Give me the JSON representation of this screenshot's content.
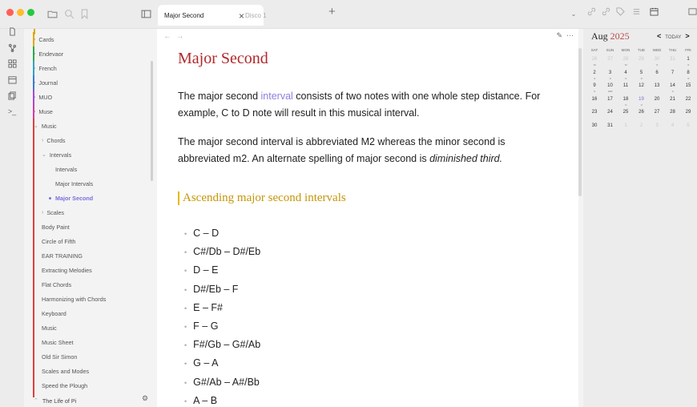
{
  "tabs": [
    {
      "label": "Major Second",
      "active": true
    },
    {
      "label": "Disco 1",
      "active": false
    }
  ],
  "sidebar": {
    "items": [
      {
        "label": "Cards",
        "color": "#e0a800",
        "chevron": ">",
        "depth": 0
      },
      {
        "label": "Endevaor",
        "color": "#2fa94f",
        "chevron": ">",
        "depth": 0
      },
      {
        "label": "French",
        "color": "#33a3c7",
        "chevron": ">",
        "depth": 0
      },
      {
        "label": "Journal",
        "color": "#3b7bd6",
        "chevron": ">",
        "depth": 0
      },
      {
        "label": "MUO",
        "color": "#a44ad8",
        "chevron": ">",
        "depth": 0
      },
      {
        "label": "Muse",
        "color": "#d63ca6",
        "chevron": ">",
        "depth": 0
      },
      {
        "label": "Music",
        "color": "#e13d3d",
        "chevron": "v",
        "depth": 0
      },
      {
        "label": "Chords",
        "chevron": ">",
        "depth": 1
      },
      {
        "label": "Intervals",
        "chevron": "v",
        "depth": 1
      },
      {
        "label": "Intervals",
        "depth": 2
      },
      {
        "label": "Major Intervals",
        "depth": 2
      },
      {
        "label": "Major Second",
        "depth": 2,
        "selected": true
      },
      {
        "label": "Scales",
        "chevron": ">",
        "depth": 1
      },
      {
        "label": "Body Paint",
        "depth": 1
      },
      {
        "label": "Circle of Fifth",
        "depth": 1
      },
      {
        "label": "EAR TRAINING",
        "depth": 1
      },
      {
        "label": "Extracting Melodies",
        "depth": 1
      },
      {
        "label": "Flat Chords",
        "depth": 1
      },
      {
        "label": "Harmonizing with Chords",
        "depth": 1
      },
      {
        "label": "Keyboard",
        "depth": 1
      },
      {
        "label": "Music",
        "depth": 1
      },
      {
        "label": "Music Sheet",
        "depth": 1
      },
      {
        "label": "Old Sir Simon",
        "depth": 1
      },
      {
        "label": "Scales and Modes",
        "depth": 1
      },
      {
        "label": "Speed the Plough",
        "depth": 1
      }
    ],
    "vault_name": "The Life of Pi"
  },
  "note": {
    "title": "Major Second",
    "para1_before": "The major second ",
    "para1_link": "interval",
    "para1_after": " consists of two notes with one whole step distance. For example, C to D note will result in this musical interval.",
    "para2_before": "The major second interval is abbreviated M2 whereas the minor second is abbreviated m2. An alternate spelling of major second is ",
    "para2_em": "diminished third.",
    "heading": "Ascending major second intervals",
    "list": [
      "C – D",
      "C#/Db – D#/Eb",
      "D – E",
      "D#/Eb – F",
      "E – F#",
      "F – G",
      "F#/Gb – G#/Ab",
      "G – A",
      "G#/Ab – A#/Bb",
      "A – B"
    ]
  },
  "calendar": {
    "month": "Aug",
    "year": "2025",
    "today_label": "TODAY",
    "prev": "<",
    "next": ">",
    "weekdays": [
      "SAT",
      "SUN",
      "MON",
      "TUE",
      "WED",
      "THU",
      "FRI"
    ],
    "weeks": [
      [
        {
          "d": "26",
          "dim": true,
          "dots": "•••"
        },
        {
          "d": "27",
          "dim": true
        },
        {
          "d": "28",
          "dim": true,
          "dots": "•••"
        },
        {
          "d": "29",
          "dim": true
        },
        {
          "d": "30",
          "dim": true,
          "dots": "••"
        },
        {
          "d": "31",
          "dim": true
        },
        {
          "d": "1",
          "dots": "••"
        }
      ],
      [
        {
          "d": "2",
          "dots": "••"
        },
        {
          "d": "3",
          "dots": "••"
        },
        {
          "d": "4",
          "dots": "••"
        },
        {
          "d": "5",
          "dots": "••"
        },
        {
          "d": "6"
        },
        {
          "d": "7"
        },
        {
          "d": "8",
          "dots": "••"
        }
      ],
      [
        {
          "d": "9",
          "dots": "••"
        },
        {
          "d": "10",
          "dots": "••••••"
        },
        {
          "d": "11"
        },
        {
          "d": "12"
        },
        {
          "d": "13"
        },
        {
          "d": "14",
          "dots": "••"
        },
        {
          "d": "15"
        }
      ],
      [
        {
          "d": "16"
        },
        {
          "d": "17"
        },
        {
          "d": "18",
          "dots": "••"
        },
        {
          "d": "19",
          "today": true,
          "dots": "••"
        },
        {
          "d": "20"
        },
        {
          "d": "21"
        },
        {
          "d": "22"
        }
      ],
      [
        {
          "d": "23"
        },
        {
          "d": "24"
        },
        {
          "d": "25"
        },
        {
          "d": "26"
        },
        {
          "d": "27"
        },
        {
          "d": "28"
        },
        {
          "d": "29"
        }
      ],
      [
        {
          "d": "30"
        },
        {
          "d": "31"
        },
        {
          "d": "1",
          "dim": true
        },
        {
          "d": "2",
          "dim": true
        },
        {
          "d": "3",
          "dim": true
        },
        {
          "d": "4",
          "dim": true
        },
        {
          "d": "5",
          "dim": true
        }
      ]
    ]
  },
  "colors": {
    "accent": "#7a6fde",
    "title_red": "#b0282b",
    "heading_gold": "#c4960a"
  }
}
